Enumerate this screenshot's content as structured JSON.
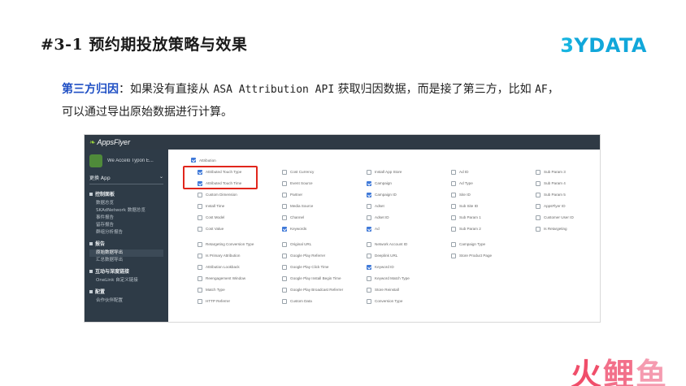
{
  "slide": {
    "title": "#3-1 预约期投放策略与效果",
    "brand_3": "3",
    "brand_rest": "YDATA",
    "highlight": "第三方归因",
    "line1_a": "：如果没有直接从 ",
    "line1_api": "ASA Attribution API",
    "line1_b": " 获取归因数据，而是接了第三方，比如 ",
    "line1_af": "AF",
    "line1_c": "，",
    "line2": "可以通过导出原始数据进行计算。",
    "watermark": [
      "火",
      "鲤",
      "鱼"
    ]
  },
  "appsflyer": {
    "logo": "AppsFlyer",
    "app_name": "We Accelo Typon E...",
    "app_select": "更换 App",
    "nav": [
      {
        "group": "控制面板",
        "items": [
          "数据总览",
          "SKAdNetwork 数据总览",
          "事件报告",
          "留存报告",
          "群组分析报告"
        ]
      },
      {
        "group": "报告",
        "items": [
          "原始数据导出",
          "汇总数据导出"
        ]
      },
      {
        "group": "互动与深度链接",
        "items": [
          "OneLink 自定义链接"
        ]
      },
      {
        "group": "配置",
        "items": [
          "合作伙伴配置"
        ]
      }
    ],
    "attribution_label": "Attribution",
    "attribution_checked": true,
    "columns": [
      [
        {
          "label": "Attributed Touch Type",
          "checked": true
        },
        {
          "label": "Attributed Touch Time",
          "checked": true
        },
        {
          "label": "Custom Dimension",
          "checked": false
        },
        {
          "label": "Install Time",
          "checked": false
        },
        {
          "label": "Cost Model",
          "checked": false
        },
        {
          "label": "Cost Value",
          "checked": false
        },
        {
          "label": "Retargeting Conversion Type",
          "checked": false
        },
        {
          "label": "Is Primary Attribution",
          "checked": false
        },
        {
          "label": "Attribution Lookback",
          "checked": false
        },
        {
          "label": "Reengagement Window",
          "checked": false
        },
        {
          "label": "Match Type",
          "checked": false
        },
        {
          "label": "HTTP Referrer",
          "checked": false
        }
      ],
      [
        {
          "label": "Cost Currency",
          "checked": false
        },
        {
          "label": "Event Source",
          "checked": false
        },
        {
          "label": "Partner",
          "checked": false
        },
        {
          "label": "Media Source",
          "checked": false
        },
        {
          "label": "Channel",
          "checked": false
        },
        {
          "label": "Keywords",
          "checked": true
        },
        {
          "label": "Original URL",
          "checked": false
        },
        {
          "label": "Google Play Referrer",
          "checked": false
        },
        {
          "label": "Google Play Click Time",
          "checked": false
        },
        {
          "label": "Google Play Install Begin Time",
          "checked": false
        },
        {
          "label": "Google Play Broadcast Referrer",
          "checked": false
        },
        {
          "label": "Custom Data",
          "checked": false
        }
      ],
      [
        {
          "label": "Install App Store",
          "checked": false
        },
        {
          "label": "Campaign",
          "checked": true
        },
        {
          "label": "Campaign ID",
          "checked": true
        },
        {
          "label": "Adset",
          "checked": false
        },
        {
          "label": "Adset ID",
          "checked": false
        },
        {
          "label": "Ad",
          "checked": true
        },
        {
          "label": "Network Account ID",
          "checked": false
        },
        {
          "label": "Deeplink URL",
          "checked": false
        },
        {
          "label": "Keyword ID",
          "checked": true
        },
        {
          "label": "Keyword Match Type",
          "checked": false
        },
        {
          "label": "Store Reinstall",
          "checked": false
        },
        {
          "label": "Conversion Type",
          "checked": false
        }
      ],
      [
        {
          "label": "Ad ID",
          "checked": false
        },
        {
          "label": "Ad Type",
          "checked": false
        },
        {
          "label": "Site ID",
          "checked": false
        },
        {
          "label": "Sub Site ID",
          "checked": false
        },
        {
          "label": "Sub Param 1",
          "checked": false
        },
        {
          "label": "Sub Param 2",
          "checked": false
        },
        {
          "label": "Campaign Type",
          "checked": false
        },
        {
          "label": "Store Product Page",
          "checked": false
        }
      ],
      [
        {
          "label": "Sub Param 3",
          "checked": false
        },
        {
          "label": "Sub Param 4",
          "checked": false
        },
        {
          "label": "Sub Param 5",
          "checked": false
        },
        {
          "label": "AppsFlyer ID",
          "checked": false
        },
        {
          "label": "Customer User ID",
          "checked": false
        },
        {
          "label": "Is Retargeting",
          "checked": false
        }
      ]
    ]
  }
}
